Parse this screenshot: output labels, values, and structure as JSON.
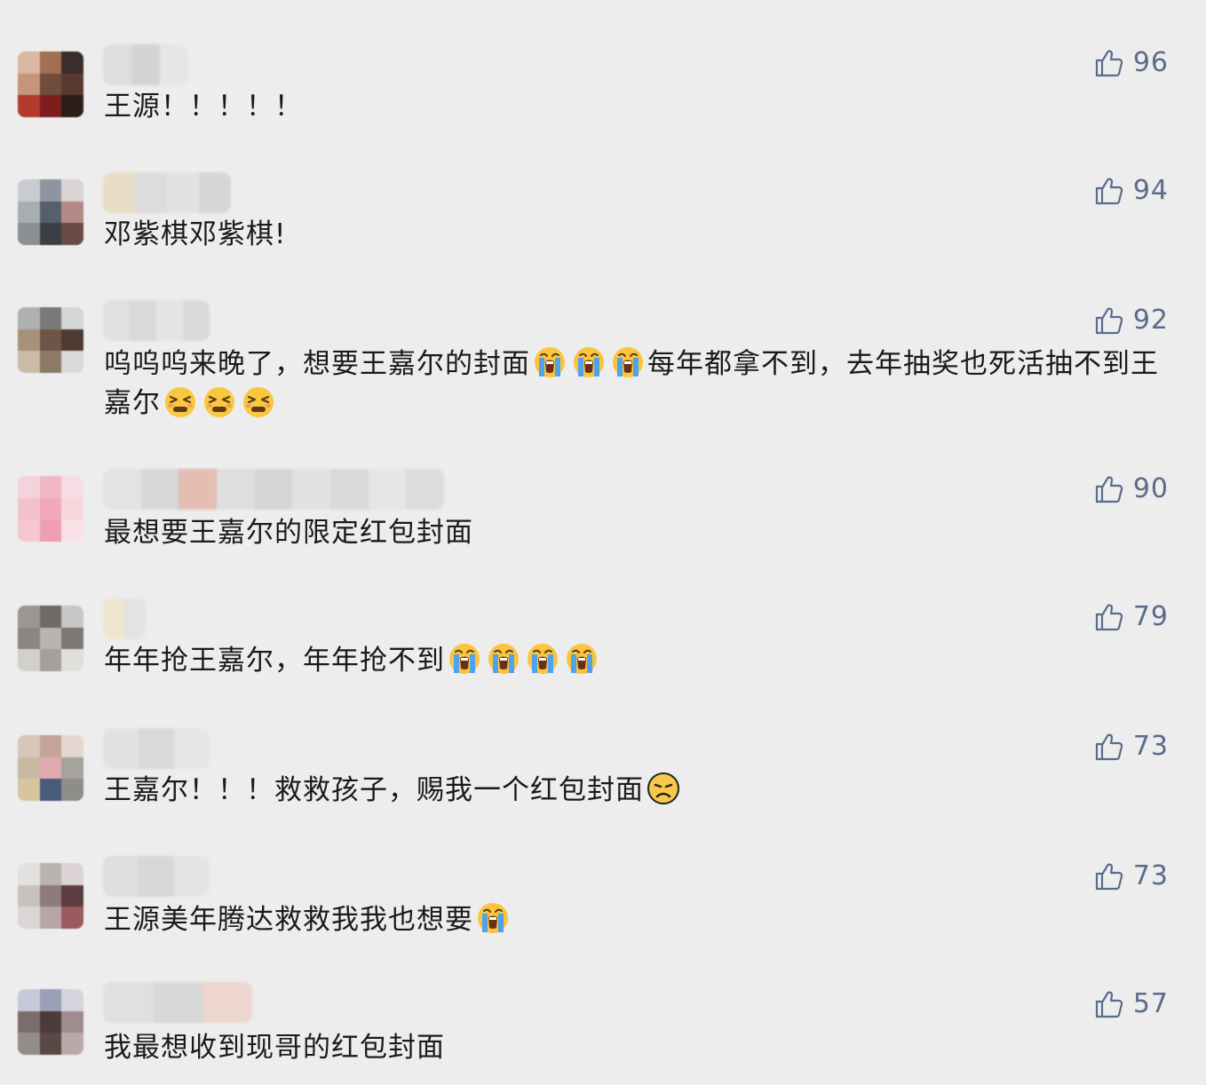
{
  "colors": {
    "background": "#ededed",
    "text": "#1a1a1a",
    "like_accent": "#5b6b8c"
  },
  "icons": {
    "like": "thumbs-up-outline-icon",
    "crying": "loudly-crying-face-emoji",
    "persevering": "persevering-face-emoji",
    "frowning": "frowning-face-emoji"
  },
  "comments": [
    {
      "avatar_colors": [
        "#d9b7a0",
        "#a26f53",
        "#3b2e2a",
        "#c69478",
        "#6f4c3e",
        "#5a3a30",
        "#b33a2c",
        "#7c1f1c",
        "#2d1d1a"
      ],
      "name_colors": [
        "#dedede",
        "#d4d4d4",
        "#e6e6e6"
      ],
      "segments": [
        {
          "text": "王源！！！！！"
        }
      ],
      "likes": "96"
    },
    {
      "avatar_colors": [
        "#c8ccd0",
        "#8d96a0",
        "#d8d4d3",
        "#a7adb3",
        "#55606c",
        "#b48a86",
        "#8c9094",
        "#3b3e44",
        "#6a4a45"
      ],
      "name_colors": [
        "#e9dcc4",
        "#dcdcdc",
        "#e2e2e2",
        "#d6d6d6"
      ],
      "segments": [
        {
          "text": "邓紫棋邓紫棋!"
        }
      ],
      "likes": "94"
    },
    {
      "avatar_colors": [
        "#b0b0b0",
        "#7a7a78",
        "#d5d5d5",
        "#a59278",
        "#6e5646",
        "#4d3a30",
        "#c9bba5",
        "#8c7a66",
        "#d9d9d9"
      ],
      "name_colors": [
        "#e0e0e0",
        "#d9d9d9",
        "#e4e4e4",
        "#dadada"
      ],
      "segments": [
        {
          "text": "呜呜呜来晚了，想要王嘉尔的封面"
        },
        {
          "emoji": "crying"
        },
        {
          "emoji": "crying"
        },
        {
          "emoji": "crying"
        },
        {
          "text": "每年都拿不到，去年抽奖也死活抽不到王嘉尔"
        },
        {
          "emoji": "persevering"
        },
        {
          "emoji": "persevering"
        },
        {
          "emoji": "persevering"
        }
      ],
      "likes": "92"
    },
    {
      "avatar_colors": [
        "#f5d3dc",
        "#f0b8c6",
        "#f6dde3",
        "#f3c1cd",
        "#f0a8bb",
        "#f7d6de",
        "#f4c7d2",
        "#ef9db2",
        "#f8e1e7"
      ],
      "name_colors": [
        "#e3e3e3",
        "#d8d8d8",
        "#e4bdb3",
        "#dedede",
        "#d5d5d5",
        "#e2e2e2",
        "#d9d9d9",
        "#e6e6e6",
        "#dcdcdc"
      ],
      "segments": [
        {
          "text": "最想要王嘉尔的限定红包封面"
        }
      ],
      "likes": "90"
    },
    {
      "avatar_colors": [
        "#9a9694",
        "#6e6a68",
        "#c9c7c5",
        "#8a8683",
        "#b8b4b0",
        "#7c7875",
        "#d2d0cc",
        "#a3a09d",
        "#e0dfdc"
      ],
      "name_colors": [
        "#efe6cf",
        "#e3e3e3"
      ],
      "segments": [
        {
          "text": "年年抢王嘉尔，年年抢不到"
        },
        {
          "emoji": "crying"
        },
        {
          "emoji": "crying"
        },
        {
          "emoji": "crying"
        },
        {
          "emoji": "crying"
        }
      ],
      "likes": "79"
    },
    {
      "avatar_colors": [
        "#d8c6bc",
        "#c3a498",
        "#e4d7cf",
        "#c9b9a3",
        "#e0aab0",
        "#a6a39d",
        "#d6c49e",
        "#4a5a7a",
        "#8f8d8a"
      ],
      "name_colors": [
        "#e2e2e2",
        "#d9d9d9",
        "#e6e6e6"
      ],
      "segments": [
        {
          "text": "王嘉尔！！！救救孩子，赐我一个红包封面"
        },
        {
          "emoji": "frowning"
        }
      ],
      "likes": "73"
    },
    {
      "avatar_colors": [
        "#e3e1e0",
        "#b9b4b1",
        "#dcd3d4",
        "#c7c2c0",
        "#8f7a7c",
        "#5d3c40",
        "#d9d6d5",
        "#b8a5a6",
        "#9b5a5e"
      ],
      "name_colors": [
        "#dedede",
        "#d8d8d8",
        "#e4e4e4"
      ],
      "segments": [
        {
          "text": "王源美年腾达救救我我也想要"
        },
        {
          "emoji": "crying"
        }
      ],
      "likes": "73"
    },
    {
      "avatar_colors": [
        "#c7c9d8",
        "#9aa0b8",
        "#d6d3dc",
        "#7b6c6e",
        "#4c3b3a",
        "#a08b8d",
        "#948c8b",
        "#5a4844",
        "#b7aaa8"
      ],
      "name_colors": [
        "#e0e0e0",
        "#d8d8d8",
        "#ecd6cf"
      ],
      "segments": [
        {
          "text": "我最想收到现哥的红包封面"
        }
      ],
      "likes": "57"
    }
  ]
}
